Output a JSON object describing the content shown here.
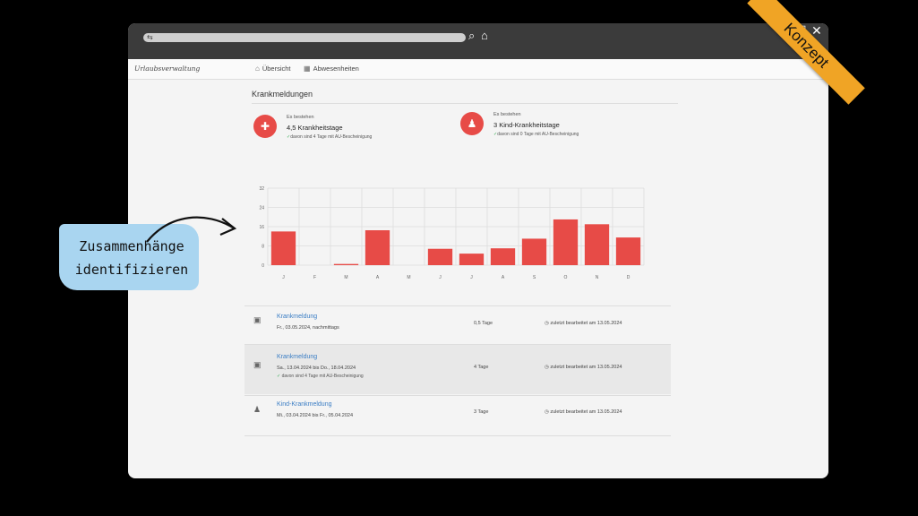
{
  "window_controls": {
    "maximize": "☐",
    "close": "✕"
  },
  "app": {
    "brand": "Urlaubsverwaltung"
  },
  "nav": [
    {
      "label": "Übersicht"
    },
    {
      "label": "Abwesenheiten"
    }
  ],
  "page": {
    "title": "Krankmeldungen"
  },
  "stats": [
    {
      "small": "Es bestehen",
      "big": "4,5 Krankheitstage",
      "note": "davon sind 4 Tage mit AU-Bescheinigung"
    },
    {
      "small": "Es bestehen",
      "big": "3 Kind-Krankheitstage",
      "note": "davon sind 0 Tage mit AU-Bescheinigung"
    }
  ],
  "chart_data": {
    "type": "bar",
    "categories": [
      "J",
      "F",
      "M",
      "A",
      "M",
      "J",
      "J",
      "A",
      "S",
      "O",
      "N",
      "D"
    ],
    "values": [
      14,
      0,
      0.5,
      14.5,
      0,
      6.8,
      4.8,
      7,
      11,
      19,
      17,
      11.5
    ],
    "ylim": [
      0,
      32
    ],
    "yticks": [
      "32",
      "24",
      "16",
      "8",
      "0"
    ],
    "grid": true,
    "color": "#e74b47"
  },
  "rows": [
    {
      "title": "Krankmeldung",
      "dates": "Fr., 03.05.2024, nachmittags",
      "note": "",
      "duration": "0,5 Tage",
      "edited": "zuletzt bearbeitet am 13.05.2024"
    },
    {
      "title": "Krankmeldung",
      "dates": "Sa., 13.04.2024 bis Do., 18.04.2024",
      "note": "davon sind 4 Tage mit AU-Bescheinigung",
      "duration": "4 Tage",
      "edited": "zuletzt bearbeitet am 13.05.2024"
    },
    {
      "title": "Kind-Krankmeldung",
      "dates": "Mi., 03.04.2024 bis Fr., 05.04.2024",
      "note": "",
      "duration": "3 Tage",
      "edited": "zuletzt bearbeitet am 13.05.2024"
    }
  ],
  "ribbon": {
    "label": "Konzept"
  },
  "callout": {
    "line1": "Zusammenhänge",
    "line2": "identifizieren"
  }
}
